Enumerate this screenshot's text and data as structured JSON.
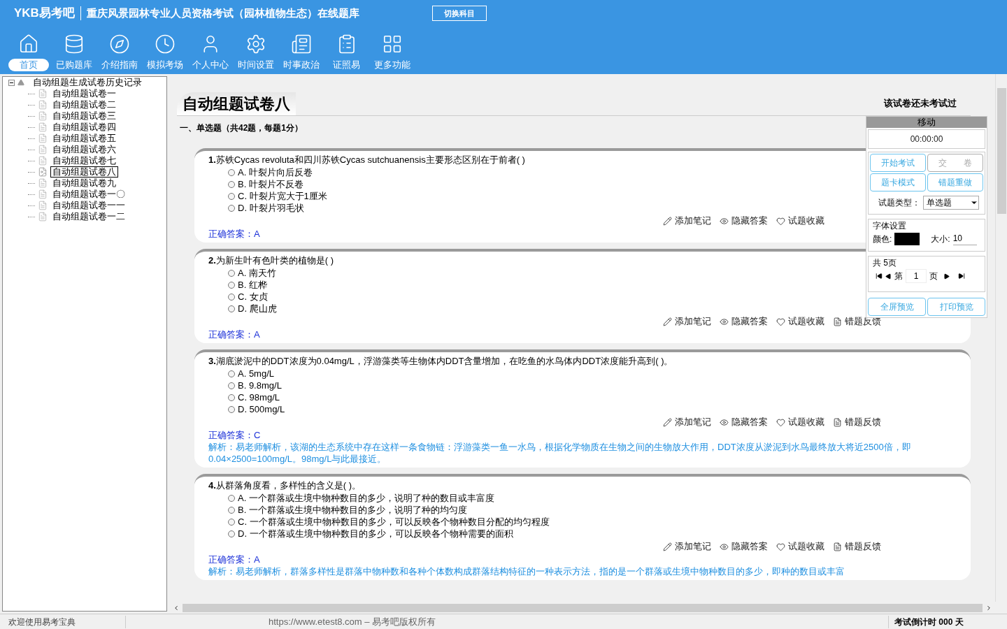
{
  "app": {
    "logo": "YKB易考吧",
    "title": "重庆风景园林专业人员资格考试（园林植物生态）在线题库",
    "switch_button": "切换科目"
  },
  "nav": [
    {
      "label": "首页",
      "selected": true
    },
    {
      "label": "已购题库",
      "selected": false
    },
    {
      "label": "介绍指南",
      "selected": false
    },
    {
      "label": "模拟考场",
      "selected": false
    },
    {
      "label": "个人中心",
      "selected": false
    },
    {
      "label": "时间设置",
      "selected": false
    },
    {
      "label": "时事政治",
      "selected": false
    },
    {
      "label": "证照易",
      "selected": false
    },
    {
      "label": "更多功能",
      "selected": false
    }
  ],
  "tree": {
    "label": "自动组题生成试卷历史记录",
    "expanded": true,
    "children": [
      {
        "label": "自动组题试卷一",
        "selected": false
      },
      {
        "label": "自动组题试卷二",
        "selected": false
      },
      {
        "label": "自动组题试卷三",
        "selected": false
      },
      {
        "label": "自动组题试卷四",
        "selected": false
      },
      {
        "label": "自动组题试卷五",
        "selected": false
      },
      {
        "label": "自动组题试卷六",
        "selected": false
      },
      {
        "label": "自动组题试卷七",
        "selected": false
      },
      {
        "label": "自动组题试卷八",
        "selected": true
      },
      {
        "label": "自动组题试卷九",
        "selected": false
      },
      {
        "label": "自动组题试卷一〇",
        "selected": false
      },
      {
        "label": "自动组题试卷一一",
        "selected": false
      },
      {
        "label": "自动组题试卷一二",
        "selected": false
      }
    ]
  },
  "paper": {
    "title": "自动组题试卷八",
    "status": "该试卷还未考试过",
    "section": "一、单选题（共42题，每题1分）"
  },
  "questions": [
    {
      "number": "1.",
      "text": "苏铁Cycas revoluta和四川苏铁Cycas sutchuanensis主要形态区别在于前者( )",
      "options": [
        {
          "label": "A. 叶裂片向后反卷",
          "selected": false
        },
        {
          "label": "B. 叶裂片不反卷",
          "selected": false
        },
        {
          "label": "C. 叶裂片宽大于1厘米",
          "selected": false
        },
        {
          "label": "D. 叶裂片羽毛状",
          "selected": false
        }
      ],
      "actions": [
        "添加笔记",
        "隐藏答案",
        "试题收藏"
      ],
      "answer": "正确答案：A"
    },
    {
      "number": "2.",
      "text": "为新生叶有色叶类的植物是( )",
      "options": [
        {
          "label": "A. 南天竹",
          "selected": false
        },
        {
          "label": "B. 红桦",
          "selected": false
        },
        {
          "label": "C. 女贞",
          "selected": false
        },
        {
          "label": "D. 爬山虎",
          "selected": false
        }
      ],
      "actions": [
        "添加笔记",
        "隐藏答案",
        "试题收藏",
        "错题反馈"
      ],
      "answer": "正确答案：A"
    },
    {
      "number": "3.",
      "text": "湖底淤泥中的DDT浓度为0.04mg/L，浮游藻类等生物体内DDT含量增加，在吃鱼的水鸟体内DDT浓度能升高到( )。",
      "options": [
        {
          "label": "A. 5mg/L",
          "selected": false
        },
        {
          "label": "B. 9.8mg/L",
          "selected": false
        },
        {
          "label": "C. 98mg/L",
          "selected": false
        },
        {
          "label": "D. 500mg/L",
          "selected": false
        }
      ],
      "actions": [
        "添加笔记",
        "隐藏答案",
        "试题收藏",
        "错题反馈"
      ],
      "answer": "正确答案：C",
      "analysis": "解析：易老师解析，该湖的生态系统中存在这样一条食物链：浮游藻类一鱼一水鸟，根据化学物质在生物之间的生物放大作用，DDT浓度从淤泥到水鸟最终放大将近2500倍，即0.04×2500=100mg/L。98mg/L与此最接近。"
    },
    {
      "number": "4.",
      "text": "从群落角度看，多样性的含义是( )。",
      "options": [
        {
          "label": "A. 一个群落或生境中物种数目的多少，说明了种的数目或丰富度",
          "selected": false
        },
        {
          "label": "B. 一个群落或生境中物种数目的多少，说明了种的均匀度",
          "selected": false
        },
        {
          "label": "C. 一个群落或生境中物种数目的多少，可以反映各个物种数目分配的均匀程度",
          "selected": false
        },
        {
          "label": "D. 一个群落或生境中物种数目的多少，可以反映各个物种需要的面积",
          "selected": false
        }
      ],
      "actions": [
        "添加笔记",
        "隐藏答案",
        "试题收藏",
        "错题反馈"
      ],
      "answer": "正确答案：A",
      "analysis": "解析：易老师解析，群落多样性是群落中物种数和各种个体数构成群落结构特征的一种表示方法，指的是一个群落或生境中物种数目的多少，即种的数目或丰富"
    }
  ],
  "panel": {
    "header": "移动",
    "timer": "00:00:00",
    "buttons": [
      {
        "label": "开始考试",
        "disabled": false
      },
      {
        "label": "交　　卷",
        "disabled": true
      },
      {
        "label": "题卡模式",
        "disabled": false
      },
      {
        "label": "错题重做",
        "disabled": false
      }
    ],
    "type_label": "试题类型：",
    "type_value": "单选题",
    "font_group": "字体设置",
    "color_label": "颜色:",
    "size_label": "大小:",
    "size_value": "10",
    "pages_group": "共 5页",
    "page_prefix": "第",
    "page_value": "1",
    "page_suffix": "页",
    "bottom_buttons": [
      "全屏预览",
      "打印预览"
    ]
  },
  "status_bar": {
    "welcome": "欢迎使用易考宝典",
    "copyright": "https://www.etest8.com – 易考吧版权所有",
    "countdown": "考试倒计时 000 天"
  }
}
